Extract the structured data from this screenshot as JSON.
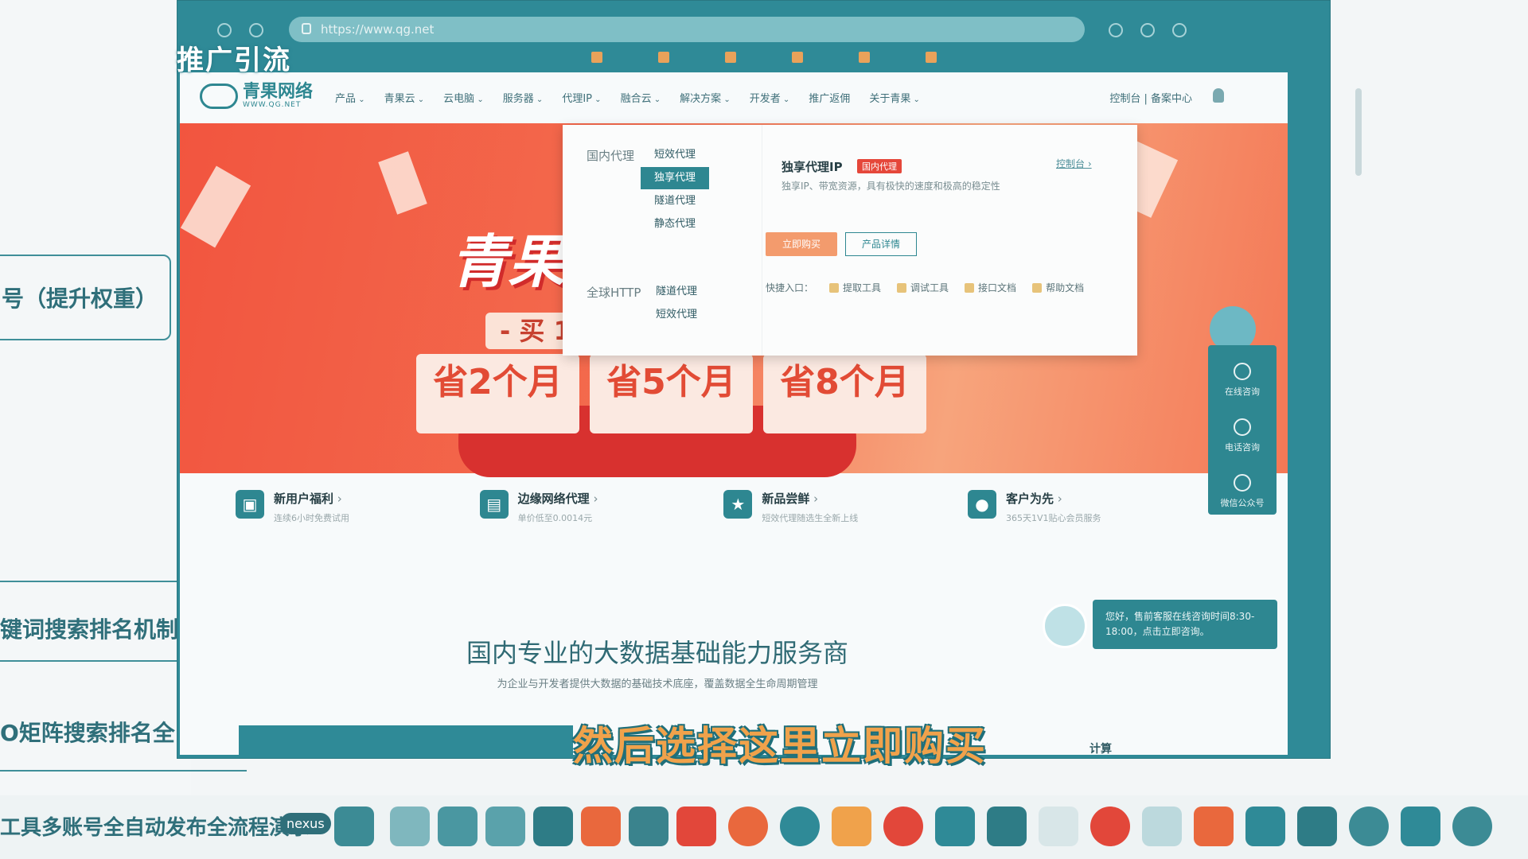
{
  "overlay": {
    "top_title": "推广引流"
  },
  "mindmap": {
    "node1": "号（提升权重）",
    "text2": "键词搜索排名机制",
    "text3": "O矩阵搜索排名全",
    "text4": "工具多账号全自动发布全流程演示"
  },
  "browser": {
    "url": "https://www.qg.net"
  },
  "site": {
    "logo_main": "青果网络",
    "logo_sub": "WWW.QG.NET",
    "nav": [
      "产品",
      "青果云",
      "云电脑",
      "服务器",
      "代理IP",
      "融合云",
      "解决方案",
      "开发者",
      "推广返佣",
      "关于青果"
    ],
    "nav_right": "控制台 | 备案中心"
  },
  "hero": {
    "title": "青果",
    "buy_text": "- 买 1",
    "save": [
      "省2个月",
      "省5个月",
      "省8个月"
    ]
  },
  "dropdown": {
    "cat_domestic": "国内代理",
    "cat_global": "全球HTTP",
    "domestic_items": [
      "短效代理",
      "独享代理",
      "隧道代理",
      "静态代理"
    ],
    "global_items": [
      "隧道代理",
      "短效代理"
    ],
    "panel_title": "独享代理IP",
    "panel_tag": "国内代理",
    "console": "控制台 ›",
    "desc": "独享IP、带宽资源，具有极快的速度和极高的稳定性",
    "buy_btn": "立即购买",
    "detail_btn": "产品详情",
    "quick_label": "快捷入口：",
    "quick_items": [
      "提取工具",
      "调试工具",
      "接口文档",
      "帮助文档"
    ]
  },
  "features": [
    {
      "icon": "gift-icon",
      "title": "新用户福利",
      "sub": "连续6小时免费试用"
    },
    {
      "icon": "document-icon",
      "title": "边缘网络代理",
      "sub": "单价低至0.0014元"
    },
    {
      "icon": "bookmark-star-icon",
      "title": "新品尝鲜",
      "sub": "短效代理随选生全新上线"
    },
    {
      "icon": "user-icon",
      "title": "客户为先",
      "sub": "365天1V1贴心会员服务"
    }
  ],
  "main": {
    "heading": "国内专业的大数据基础能力服务商",
    "sub": "为企业与开发者提供大数据的基础技术底座，覆盖数据全生命周期管理"
  },
  "side_panel": [
    "在线咨询",
    "电话咨询",
    "微信公众号"
  ],
  "chat": {
    "line1": "您好，售前客服在线咨询时间8:30-",
    "line2": "18:00，点击立即咨询。"
  },
  "calc": "计算",
  "subtitle": "然后选择这里立即购买",
  "taskbar": {
    "nexus": "nexus"
  },
  "colors": {
    "brand": "#2e8791",
    "hero_red": "#f2553f",
    "subtitle": "#f0a24b"
  }
}
